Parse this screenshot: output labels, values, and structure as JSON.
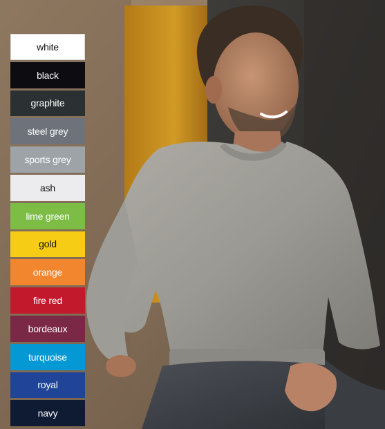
{
  "colors": [
    {
      "label": "white",
      "bg": "#ffffff",
      "fg": "#111111"
    },
    {
      "label": "black",
      "bg": "#0c0c11",
      "fg": "#ffffff"
    },
    {
      "label": "graphite",
      "bg": "#2b3032",
      "fg": "#ffffff"
    },
    {
      "label": "steel grey",
      "bg": "#6d727b",
      "fg": "#ffffff"
    },
    {
      "label": "sports grey",
      "bg": "#9ea3a7",
      "fg": "#ffffff"
    },
    {
      "label": "ash",
      "bg": "#ececee",
      "fg": "#111111"
    },
    {
      "label": "lime green",
      "bg": "#7dbd46",
      "fg": "#ffffff"
    },
    {
      "label": "gold",
      "bg": "#f7cc14",
      "fg": "#111111"
    },
    {
      "label": "orange",
      "bg": "#f1862f",
      "fg": "#ffffff"
    },
    {
      "label": "fire red",
      "bg": "#c3192d",
      "fg": "#ffffff"
    },
    {
      "label": "bordeaux",
      "bg": "#7a2845",
      "fg": "#ffffff"
    },
    {
      "label": "turquoise",
      "bg": "#0499d5",
      "fg": "#ffffff"
    },
    {
      "label": "royal",
      "bg": "#1f4498",
      "fg": "#ffffff"
    },
    {
      "label": "navy",
      "bg": "#0f1a33",
      "fg": "#ffffff"
    }
  ]
}
